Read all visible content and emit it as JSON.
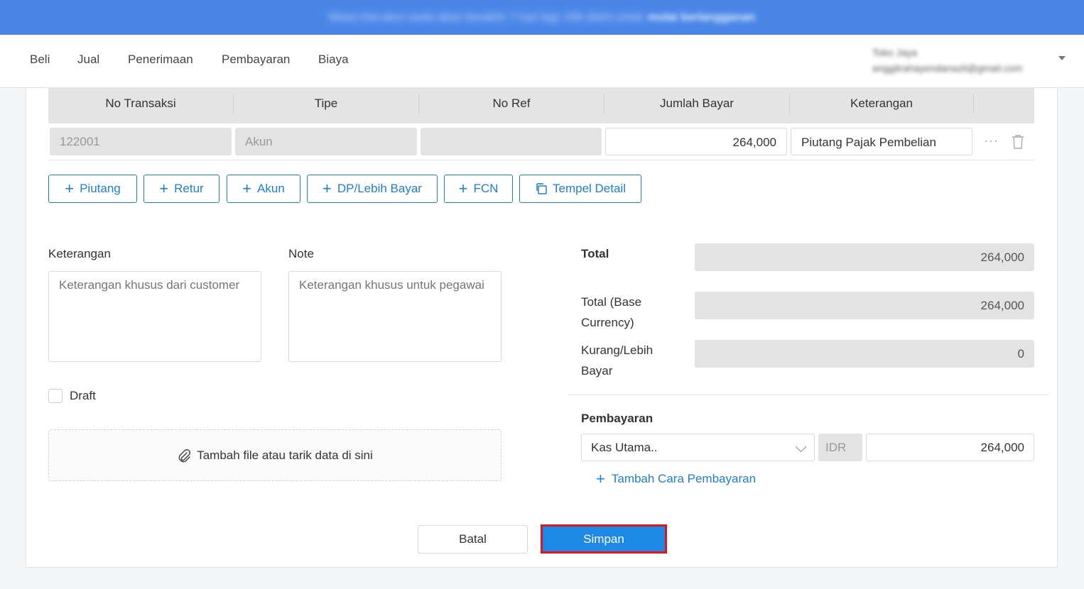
{
  "banner": {
    "text": "Masa trial akun anda akan berakhir 7 hari lagi. Klik disini untuk",
    "link": "mulai berlangganan"
  },
  "nav": {
    "items": [
      "Beli",
      "Jual",
      "Penerimaan",
      "Pembayaran",
      "Biaya"
    ]
  },
  "user": {
    "name": "Toko Jaya",
    "email": "anggitrahayendanazli@gmail.com"
  },
  "table": {
    "headers": [
      "No Transaksi",
      "Tipe",
      "No Ref",
      "Jumlah Bayar",
      "Keterangan"
    ],
    "row": {
      "no_transaksi": "122001",
      "tipe": "Akun",
      "no_ref": "",
      "jumlah_bayar": "264,000",
      "keterangan": "Piutang Pajak Pembelian"
    },
    "more_icon": "ellipsis-icon",
    "delete_icon": "trash-icon"
  },
  "add_buttons": [
    "Piutang",
    "Retur",
    "Akun",
    "DP/Lebih Bayar",
    "FCN"
  ],
  "paste_button": "Tempel Detail",
  "keterangan": {
    "label": "Keterangan",
    "placeholder": "Keterangan khusus dari customer"
  },
  "note": {
    "label": "Note",
    "placeholder": "Keterangan khusus untuk pegawai"
  },
  "draft_label": "Draft",
  "attachment": {
    "label": "Tambah file atau tarik data di sini",
    "icon": "paperclip-icon"
  },
  "summary": {
    "total_label": "Total",
    "total_value": "264,000",
    "base_label_1": "Total (Base",
    "base_label_2": "Currency)",
    "base_value": "264,000",
    "kurang_label_1": "Kurang/Lebih",
    "kurang_label_2": "Bayar",
    "kurang_value": "0"
  },
  "payment": {
    "title": "Pembayaran",
    "method": "Kas Utama..",
    "currency": "IDR",
    "amount": "264,000",
    "add_label": "Tambah Cara Pembayaran"
  },
  "actions": {
    "cancel": "Batal",
    "save": "Simpan"
  },
  "colors": {
    "primary": "#1e7ed0",
    "banner": "#4a86e8",
    "highlight": "#e0141b"
  }
}
